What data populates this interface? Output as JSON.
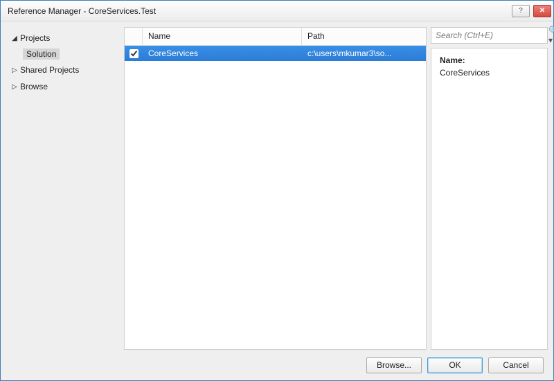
{
  "window": {
    "title": "Reference Manager - CoreServices.Test"
  },
  "sidebar": {
    "items": [
      {
        "label": "Projects",
        "expanded": true,
        "children": [
          {
            "label": "Solution",
            "selected": true
          }
        ]
      },
      {
        "label": "Shared Projects",
        "expanded": false
      },
      {
        "label": "Browse",
        "expanded": false
      }
    ]
  },
  "search": {
    "placeholder": "Search (Ctrl+E)"
  },
  "list": {
    "columns": {
      "name": "Name",
      "path": "Path"
    },
    "rows": [
      {
        "checked": true,
        "name": "CoreServices",
        "path": "c:\\users\\mkumar3\\so..."
      }
    ]
  },
  "detail": {
    "label": "Name:",
    "value": "CoreServices"
  },
  "buttons": {
    "browse": "Browse...",
    "ok": "OK",
    "cancel": "Cancel"
  }
}
